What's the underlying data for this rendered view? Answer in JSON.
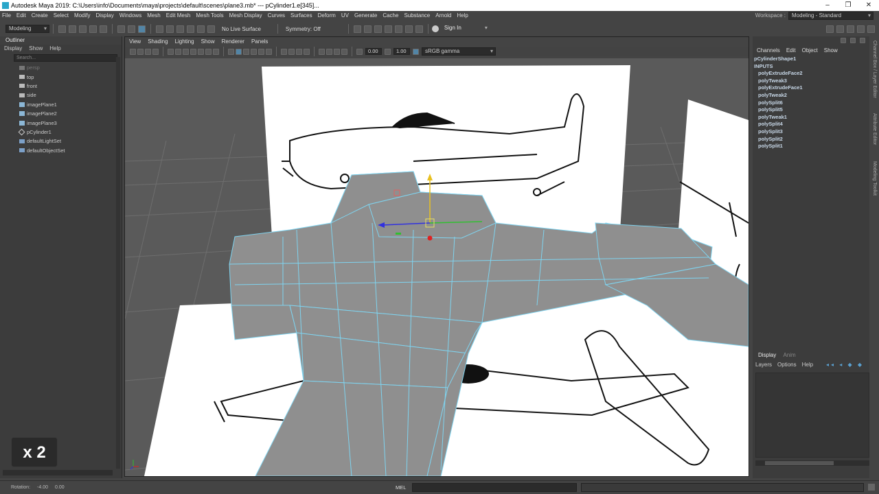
{
  "titlebar": {
    "title": "Autodesk Maya 2019: C:\\Users\\info\\Documents\\maya\\projects\\default\\scenes\\plane3.mb*   ---   pCylinder1.e[345]...",
    "buttons": [
      "–",
      "❐",
      "✕"
    ]
  },
  "menubar": {
    "items": [
      "File",
      "Edit",
      "Create",
      "Select",
      "Modify",
      "Display",
      "Windows",
      "Mesh",
      "Edit Mesh",
      "Mesh Tools",
      "Mesh Display",
      "Curves",
      "Surfaces",
      "Deform",
      "UV",
      "Generate",
      "Cache",
      "Substance",
      "Arnold",
      "Help"
    ],
    "workspace_label": "Workspace :",
    "workspace_value": "Modeling - Standard"
  },
  "shelf": {
    "mode": "Modeling",
    "live_surface": "No Live Surface",
    "symmetry": "Symmetry: Off",
    "sign_in": "Sign In"
  },
  "outliner": {
    "title": "Outliner",
    "menu": [
      "Display",
      "Show",
      "Help"
    ],
    "search_placeholder": "Search...",
    "items": [
      {
        "label": "persp",
        "icon": "camera-icon",
        "dim": true
      },
      {
        "label": "top",
        "icon": "camera-icon"
      },
      {
        "label": "front",
        "icon": "camera-icon"
      },
      {
        "label": "side",
        "icon": "camera-icon"
      },
      {
        "label": "imagePlane1",
        "icon": "image-plane-icon"
      },
      {
        "label": "imagePlane2",
        "icon": "image-plane-icon"
      },
      {
        "label": "imagePlane3",
        "icon": "image-plane-icon"
      },
      {
        "label": "pCylinder1",
        "icon": "mesh-icon"
      },
      {
        "label": "defaultLightSet",
        "icon": "set-icon"
      },
      {
        "label": "defaultObjectSet",
        "icon": "set-icon"
      }
    ]
  },
  "overlay": {
    "speed": "x 2"
  },
  "viewport": {
    "menu": [
      "View",
      "Shading",
      "Lighting",
      "Show",
      "Renderer",
      "Panels"
    ],
    "field_a": "0.00",
    "field_b": "1.00",
    "color_space": "sRGB gamma"
  },
  "channel_box": {
    "tabs": [
      "Channels",
      "Edit",
      "Object",
      "Show"
    ],
    "shape": "pCylinderShape1",
    "inputs_label": "INPUTS",
    "inputs": [
      "polyExtrudeFace2",
      "polyTweak3",
      "polyExtrudeFace1",
      "polyTweak2",
      "polySplit6",
      "polySplit5",
      "polyTweak1",
      "polySplit4",
      "polySplit3",
      "polySplit2",
      "polySplit1"
    ]
  },
  "layer_editor": {
    "tabs": [
      "Display",
      "Anim"
    ],
    "menu": [
      "Layers",
      "Options",
      "Help"
    ]
  },
  "side_tabs": [
    "Channel Box / Layer Editor",
    "Attribute Editor",
    "Modeling Toolkit"
  ],
  "status": {
    "rotation_label": "Rotation:",
    "rotation_value": "-4.00",
    "value2": "0.00",
    "mel": "MEL"
  },
  "colors": {
    "accent": "#5285a6",
    "wire": "#7fd4f0"
  }
}
